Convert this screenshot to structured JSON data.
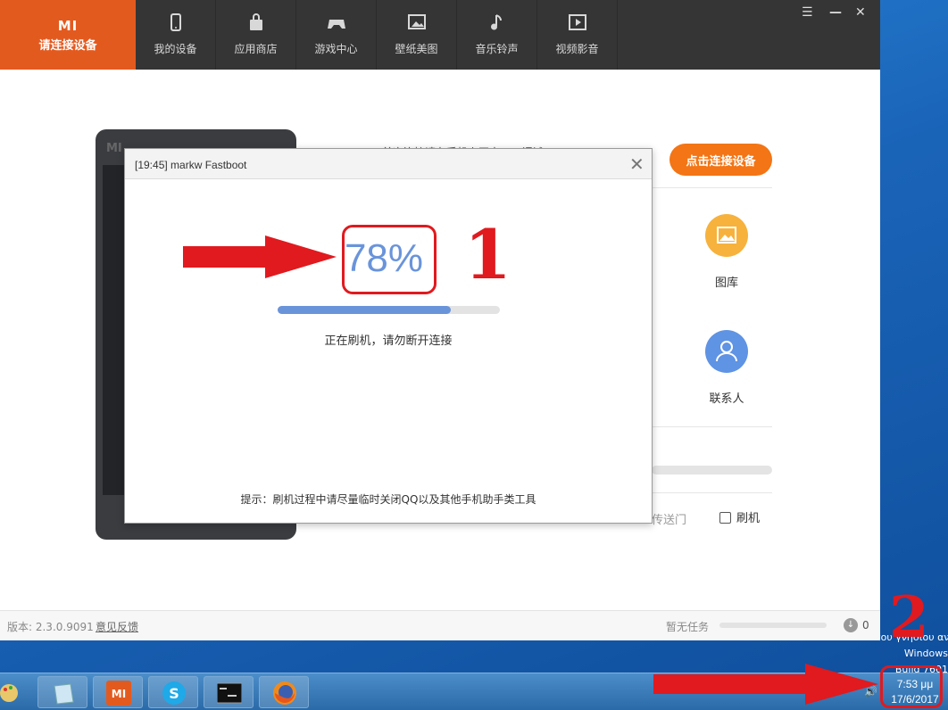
{
  "window": {
    "brand_logo": "MI",
    "brand_label": "请连接设备",
    "nav_tabs": [
      {
        "label": "我的设备",
        "icon": "phone-icon"
      },
      {
        "label": "应用商店",
        "icon": "bag-icon"
      },
      {
        "label": "游戏中心",
        "icon": "gamepad-icon"
      },
      {
        "label": "壁纸美图",
        "icon": "picture-icon"
      },
      {
        "label": "音乐铃声",
        "icon": "music-note-icon"
      },
      {
        "label": "视频影音",
        "icon": "video-play-icon"
      }
    ],
    "controls": [
      "menu-icon",
      "minimize-icon",
      "close-icon"
    ]
  },
  "main": {
    "phone_logo": "MI",
    "hint_text": "首次连接请在手机上开启USB调试",
    "connect_button": "点击连接设备",
    "features": [
      {
        "label": "图库",
        "icon": "gallery-icon",
        "color": "#f6b23d"
      },
      {
        "label": "联系人",
        "icon": "contact-icon",
        "color": "#5f93e4"
      }
    ],
    "bottom_links": {
      "transfer": "传送门",
      "flash": "刷机"
    }
  },
  "dialog": {
    "title": "[19:45] markw Fastboot",
    "percent_text": "78%",
    "progress": 0.78,
    "status": "正在刷机，请勿断开连接",
    "tip": "提示：刷机过程中请尽量临时关闭QQ以及其他手机助手类工具"
  },
  "statusbar": {
    "version": "版本: 2.3.0.9091",
    "feedback": "意见反馈",
    "task_label": "暂无任务",
    "download_count": "0"
  },
  "desktop_text": [
    "του γνήσιου αντιγράφου",
    "Windows",
    "Build 7601"
  ],
  "taskbar": {
    "apps": [
      "paint-icon",
      "notepad-icon",
      "mi-assistant-icon",
      "skype-icon",
      "cmd-icon",
      "firefox-icon"
    ],
    "clock_time": "7:53 μμ",
    "clock_date": "17/6/2017"
  },
  "annotations": {
    "label_1": "1",
    "label_2": "2",
    "color": "#e01a1f"
  },
  "colors": {
    "brand": "#e35a1f",
    "accent": "#f37515",
    "progress": "#6a94da",
    "nav_bg": "#353535"
  }
}
